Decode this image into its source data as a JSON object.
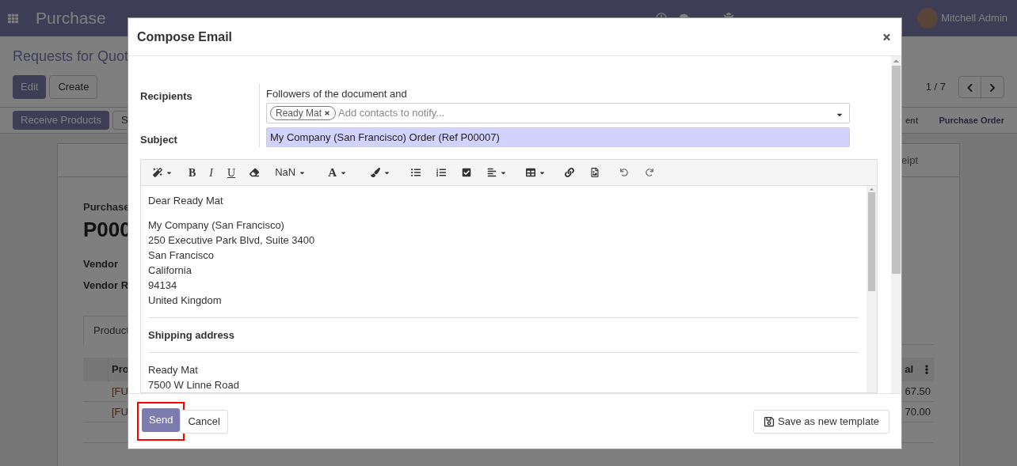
{
  "navbar": {
    "app": "Purchase",
    "user": "Mitchell Admin"
  },
  "control_panel": {
    "breadcrumb": "Requests for Quot",
    "buttons": [
      "Edit",
      "Create"
    ],
    "pager": "1 / 7",
    "actions": [
      "Receive Products",
      "S"
    ],
    "status_steps": [
      {
        "label": "ent",
        "selected": false
      },
      {
        "label": "Purchase Order",
        "selected": true
      }
    ]
  },
  "sheet": {
    "smart_button": "eipt",
    "title_label": "Purchase",
    "title": "P000",
    "fields": [
      "Vendor",
      "Vendor R"
    ],
    "notebook_tab": "Product",
    "table": {
      "columns": [
        "Pro",
        "al"
      ],
      "rows": [
        [
          "[FU",
          "67.50"
        ],
        [
          "[FU",
          "70.00"
        ]
      ]
    }
  },
  "dialog": {
    "title": "Compose Email",
    "recipients_label": "Recipients",
    "followers_text": "Followers of the document and",
    "tags": [
      {
        "label": "Ready Mat"
      }
    ],
    "recipients_placeholder": "Add contacts to notify...",
    "subject_label": "Subject",
    "subject": "My Company (San Francisco) Order (Ref P00007)",
    "toolbar": {
      "bold": "B",
      "italic": "I",
      "underline": "U",
      "font_size": "NaN",
      "font_color": "A"
    },
    "body": [
      {
        "kind": "text",
        "text": "Dear Ready Mat"
      },
      {
        "kind": "blank"
      },
      {
        "kind": "text",
        "text": "My Company (San Francisco)"
      },
      {
        "kind": "text",
        "text": "250 Executive Park Blvd, Suite 3400"
      },
      {
        "kind": "text",
        "text": "San Francisco"
      },
      {
        "kind": "text",
        "text": "California"
      },
      {
        "kind": "text",
        "text": "94134"
      },
      {
        "kind": "text",
        "text": "United Kingdom"
      },
      {
        "kind": "rule"
      },
      {
        "kind": "heading",
        "text": "Shipping address"
      },
      {
        "kind": "rule"
      },
      {
        "kind": "text",
        "text": "Ready Mat"
      },
      {
        "kind": "text",
        "text": "7500 W Linne Road"
      }
    ],
    "buttons": {
      "send": "Send",
      "cancel": "Cancel",
      "save_template": "Save as new template"
    }
  }
}
